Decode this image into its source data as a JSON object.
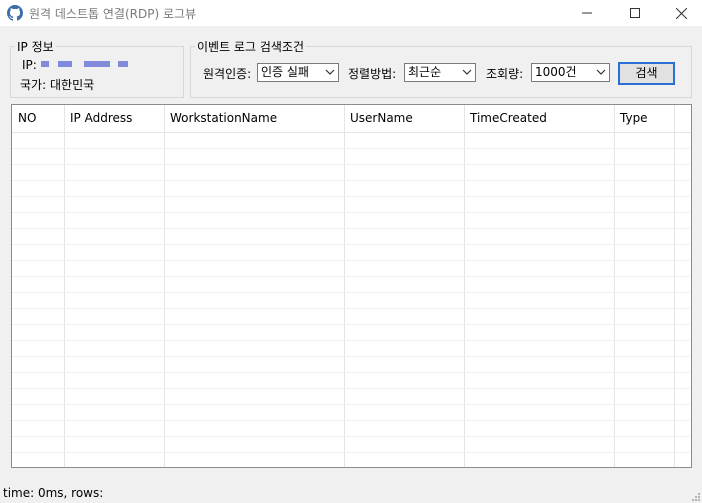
{
  "window": {
    "title": "원격 데스트톱 연결(RDP) 로그뷰",
    "controls": {
      "minimize": "—",
      "maximize": "☐",
      "close": "✕"
    }
  },
  "ip_group": {
    "legend": "IP 정보",
    "ip_label": "IP:",
    "ip_value_redacted": true,
    "country_label": "국가:",
    "country_value": "대한민국"
  },
  "event_group": {
    "legend": "이벤트 로그 검색조건",
    "auth_label": "원격인증:",
    "auth_value": "인증 실패",
    "sort_label": "정렬방법:",
    "sort_value": "최근순",
    "count_label": "조회량:",
    "count_value": "1000건",
    "search_button": "검색"
  },
  "grid": {
    "columns": [
      "NO",
      "IP Address",
      "WorkstationName",
      "UserName",
      "TimeCreated",
      "Type"
    ],
    "rows": []
  },
  "status": {
    "text": "time: 0ms,  rows:"
  },
  "colors": {
    "accent": "#2a6fd6",
    "redaction": "#6e78d8"
  }
}
